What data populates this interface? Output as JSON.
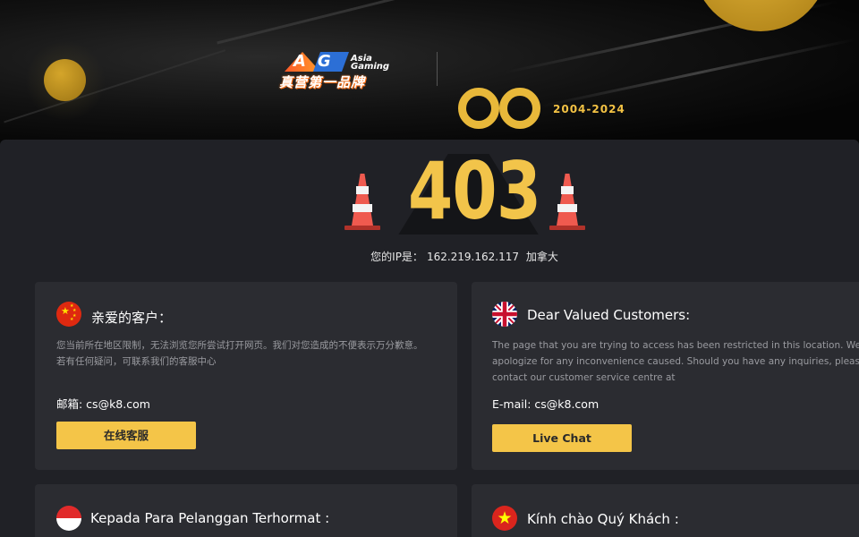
{
  "brand": {
    "logo_letters": "AG",
    "logo_asia": "Asia",
    "logo_gaming": "Gaming",
    "logo_slogan": "真营第一品牌"
  },
  "banner": {
    "year_text": "2004-2024"
  },
  "error": {
    "code": "403",
    "ip_label": "您的IP是：",
    "ip_value": "162.219.162.117",
    "ip_country": "加拿大"
  },
  "cards": {
    "zh": {
      "flag": "china-flag",
      "title": "亲爱的客户：",
      "desc": "您当前所在地区限制，无法浏览您所尝试打开网页。我们对您造成的不便表示万分歉意。若有任何疑问，可联系我们的客服中心",
      "email": "邮箱: cs@k8.com",
      "button": "在线客服"
    },
    "en": {
      "flag": "uk-flag",
      "title": "Dear Valued Customers:",
      "desc": "The page that you are trying to access has been restricted in this location. We apologize for any inconvenience caused. Should you have any inquiries, please contact our customer service centre at",
      "email": "E-mail: cs@k8.com",
      "button": "Live Chat"
    },
    "id": {
      "flag": "indonesia-flag",
      "title": "Kepada Para Pelanggan Terhormat :"
    },
    "vi": {
      "flag": "vietnam-flag",
      "title": "Kính chào Quý Khách :"
    }
  },
  "colors": {
    "accent_yellow": "#f4c548",
    "panel_bg": "#202126",
    "card_bg": "#2b2c31",
    "code_color": "#f2c44a",
    "cone_red": "#ef5a4f"
  }
}
